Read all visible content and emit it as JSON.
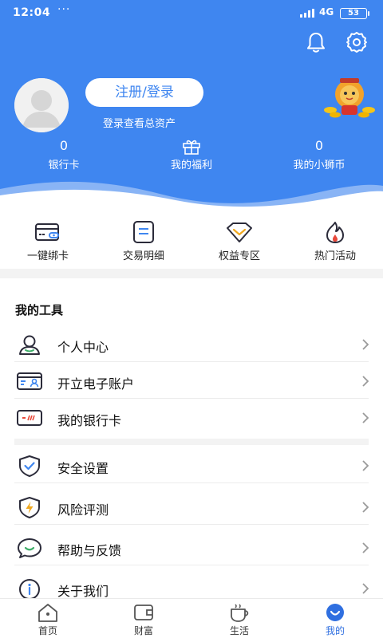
{
  "status_bar": {
    "time": "12:04",
    "dots": "···",
    "network": "4G",
    "battery": "53"
  },
  "profile": {
    "login_label": "注册/登录",
    "login_hint": "登录查看总资产"
  },
  "stats": [
    {
      "value": "0",
      "label": "银行卡"
    },
    {
      "value": "",
      "label": "我的福利"
    },
    {
      "value": "0",
      "label": "我的小狮币"
    }
  ],
  "shortcuts": [
    {
      "label": "一键绑卡",
      "icon": "card-link-icon"
    },
    {
      "label": "交易明细",
      "icon": "document-list-icon"
    },
    {
      "label": "权益专区",
      "icon": "diamond-icon"
    },
    {
      "label": "热门活动",
      "icon": "flame-icon"
    }
  ],
  "tools": {
    "title": "我的工具",
    "items": [
      {
        "label": "个人中心",
        "icon": "person-icon"
      },
      {
        "label": "开立电子账户",
        "icon": "id-card-icon"
      },
      {
        "label": "我的银行卡",
        "icon": "bank-card-icon"
      },
      {
        "label": "安全设置",
        "icon": "shield-check-icon"
      },
      {
        "label": "风险评测",
        "icon": "shield-lightning-icon"
      },
      {
        "label": "帮助与反馈",
        "icon": "chat-bubble-icon"
      },
      {
        "label": "关于我们",
        "icon": "info-icon"
      }
    ]
  },
  "tabbar": {
    "tabs": [
      {
        "label": "首页",
        "icon": "home-icon"
      },
      {
        "label": "财富",
        "icon": "wallet-icon"
      },
      {
        "label": "生活",
        "icon": "coffee-icon"
      },
      {
        "label": "我的",
        "icon": "user-smile-icon"
      }
    ],
    "active_index": 3
  },
  "colors": {
    "brand": "#3f86f0",
    "active_tab": "#2f6fe0"
  }
}
